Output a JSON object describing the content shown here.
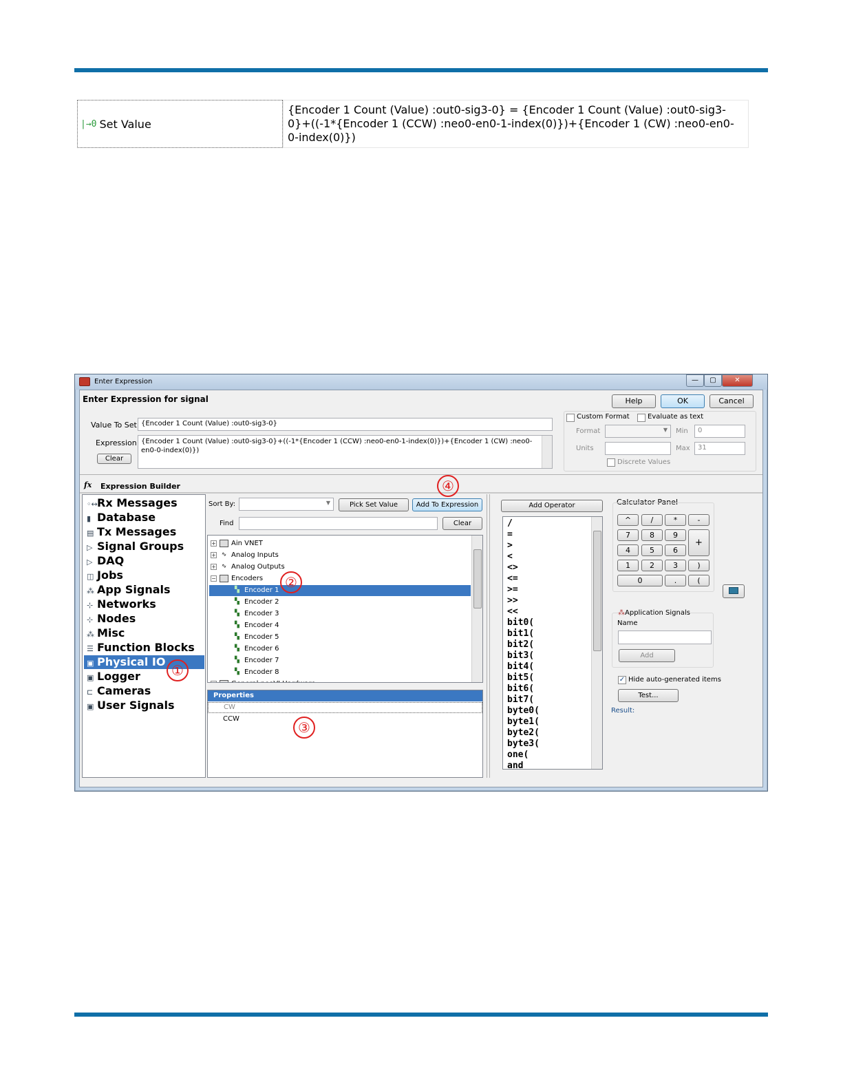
{
  "set_value_row": {
    "label": "Set Value",
    "icon": "set-value-icon",
    "expression": "{Encoder 1 Count (Value) :out0-sig3-0} = {Encoder 1 Count (Value) :out0-sig3-0}+((-1*{Encoder 1 (CCW) :neo0-en0-1-index(0)})+{Encoder 1 (CW) :neo0-en0-0-index(0)})"
  },
  "window": {
    "title": "Enter Expression",
    "heading": "Enter Expression for signal",
    "buttons": {
      "help": "Help",
      "ok": "OK",
      "cancel": "Cancel"
    },
    "value_to_set_label": "Value To Set",
    "value_to_set": "{Encoder 1 Count (Value) :out0-sig3-0}",
    "expression_label": "Expression",
    "expression_value": "{Encoder 1 Count (Value) :out0-sig3-0}+((-1*{Encoder 1 (CCW) :neo0-en0-1-index(0)})+{Encoder 1 (CW) :neo0-en0-0-index(0)})",
    "clear_label": "Clear",
    "format_options": {
      "custom_format": "Custom Format",
      "evaluate_as_text": "Evaluate as text",
      "format_label": "Format",
      "min_label": "Min",
      "min_value": "0",
      "units_label": "Units",
      "max_label": "Max",
      "max_value": "31",
      "discrete_values": "Discrete Values"
    },
    "builder_title": "Expression Builder",
    "categories": [
      {
        "label": "Rx Messages",
        "icon": "rx-messages-icon",
        "glyph": "◦↔"
      },
      {
        "label": "Database",
        "icon": "database-icon",
        "glyph": "▮"
      },
      {
        "label": "Tx Messages",
        "icon": "tx-messages-icon",
        "glyph": "▤"
      },
      {
        "label": "Signal Groups",
        "icon": "signal-groups-icon",
        "glyph": "▷"
      },
      {
        "label": "DAQ",
        "icon": "daq-icon",
        "glyph": "▷"
      },
      {
        "label": "Jobs",
        "icon": "jobs-icon",
        "glyph": "◫"
      },
      {
        "label": "App Signals",
        "icon": "app-signals-icon",
        "glyph": "⁂"
      },
      {
        "label": "Networks",
        "icon": "networks-icon",
        "glyph": "⊹"
      },
      {
        "label": "Nodes",
        "icon": "nodes-icon",
        "glyph": "⊹"
      },
      {
        "label": "Misc",
        "icon": "misc-icon",
        "glyph": "⁂"
      },
      {
        "label": "Function Blocks",
        "icon": "function-blocks-icon",
        "glyph": "☰"
      },
      {
        "label": "Physical IO",
        "icon": "physical-io-icon",
        "glyph": "▣"
      },
      {
        "label": "Logger",
        "icon": "logger-icon",
        "glyph": "▣"
      },
      {
        "label": "Cameras",
        "icon": "cameras-icon",
        "glyph": "⊏"
      },
      {
        "label": "User Signals",
        "icon": "user-signals-icon",
        "glyph": "▣"
      }
    ],
    "sort_by_label": "Sort By:",
    "pick_set_value": "Pick Set Value",
    "add_to_expression": "Add To Expression",
    "find_label": "Find",
    "find_clear": "Clear",
    "tree": {
      "top": [
        {
          "label": "Ain VNET",
          "icon": "hardware-icon",
          "glyph": ""
        },
        {
          "label": "Analog Inputs",
          "icon": "analog-inputs-icon",
          "glyph": "∿"
        },
        {
          "label": "Analog Outputs",
          "icon": "analog-outputs-icon",
          "glyph": "∿"
        },
        {
          "label": "Encoders",
          "icon": "hardware-icon",
          "glyph": ""
        }
      ],
      "encoders": [
        "Encoder 1",
        "Encoder 2",
        "Encoder 3",
        "Encoder 4",
        "Encoder 5",
        "Encoder 6",
        "Encoder 7",
        "Encoder 8"
      ],
      "cut_off": "General neoVI Hardware"
    },
    "properties": {
      "title": "Properties",
      "items": [
        "CW",
        "CCW"
      ]
    },
    "add_operator": "Add Operator",
    "operators": [
      "/",
      "=",
      ">",
      "<",
      "<>",
      "<=",
      ">=",
      ">>",
      "<<",
      "bit0(",
      "bit1(",
      "bit2(",
      "bit3(",
      "bit4(",
      "bit5(",
      "bit6(",
      "bit7(",
      "byte0(",
      "byte1(",
      "byte2(",
      "byte3(",
      "one(",
      "and"
    ],
    "calculator": {
      "title": "Calculator Panel",
      "row1": [
        "^",
        "/",
        "*",
        "-"
      ],
      "row2": [
        "7",
        "8",
        "9"
      ],
      "row3": [
        "4",
        "5",
        "6"
      ],
      "row4": [
        "1",
        "2",
        "3",
        ")"
      ],
      "row5": [
        "0",
        ".",
        "("
      ],
      "plus": "+"
    },
    "app_signals": {
      "title": "Application Signals",
      "name_label": "Name",
      "add": "Add"
    },
    "hide_auto": "Hide auto-generated items",
    "test": "Test...",
    "result": "Result:"
  },
  "callouts": [
    "①",
    "②",
    "③",
    "④"
  ],
  "colors": {
    "rule": "#0f6fa8",
    "selection": "#3b78c2",
    "callout": "#e02020"
  }
}
